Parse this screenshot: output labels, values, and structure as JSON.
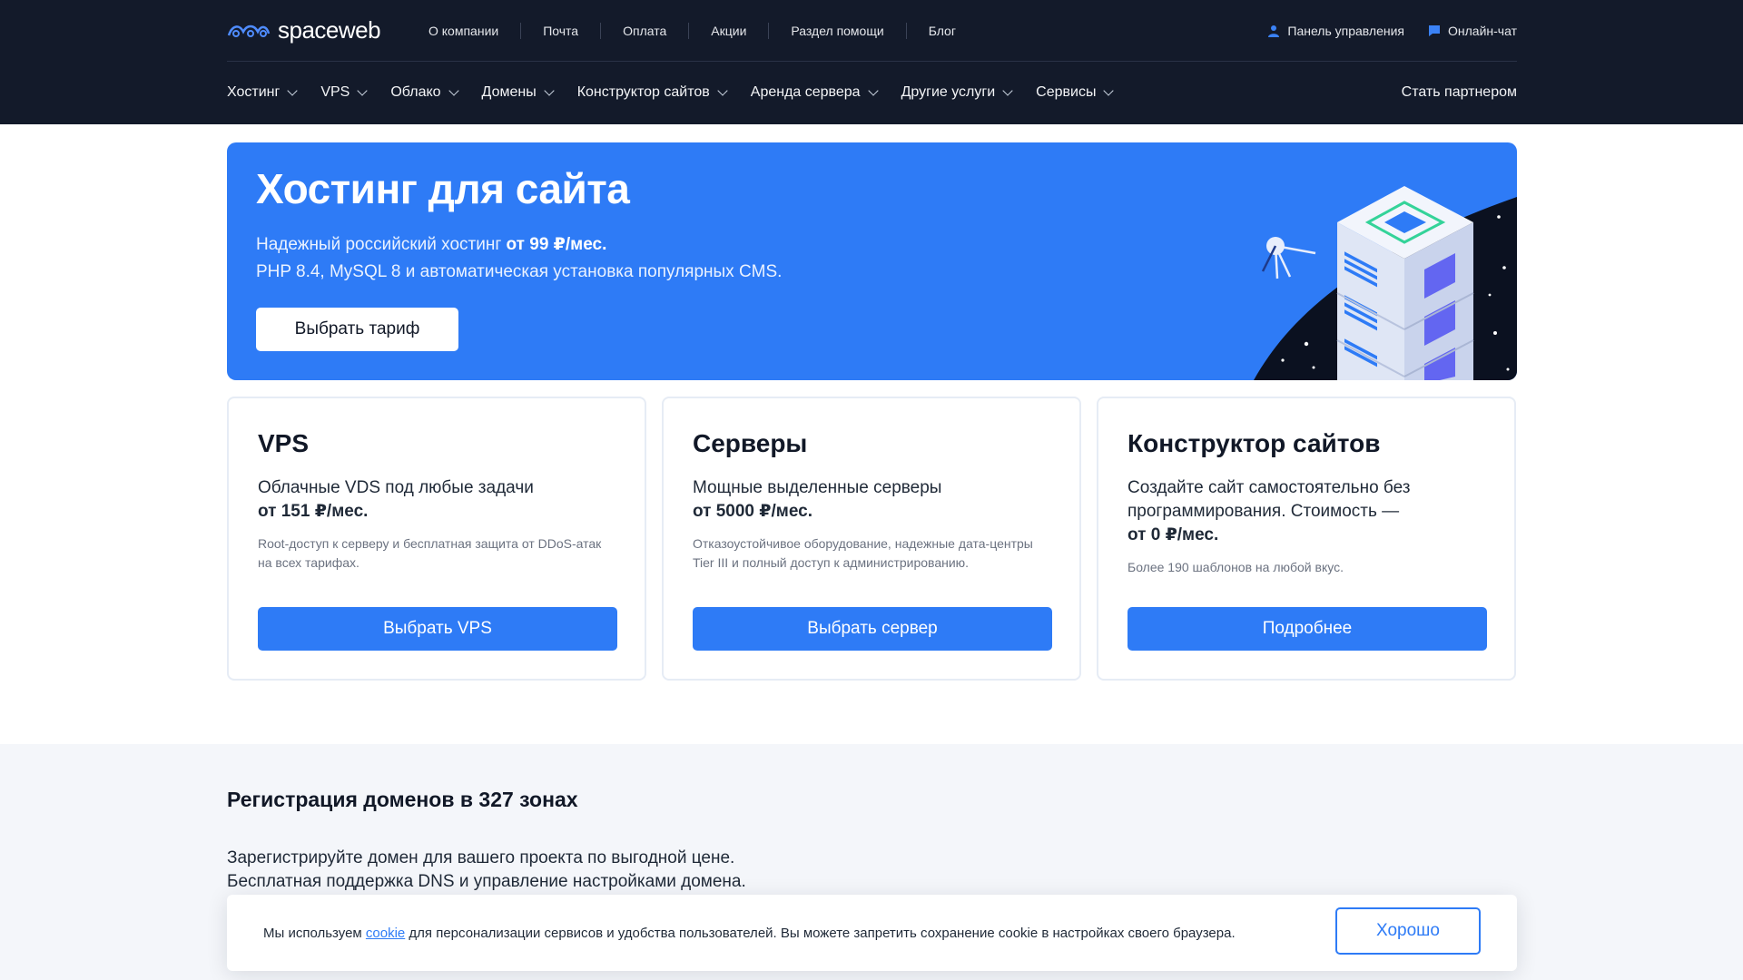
{
  "brand": {
    "name": "spaceweb",
    "accent": "#2e7bf6",
    "header_bg": "#131a2a"
  },
  "topnav": {
    "links": [
      "О компании",
      "Почта",
      "Оплата",
      "Акции",
      "Раздел помощи",
      "Блог"
    ],
    "control_panel": "Панель управления",
    "chat": "Онлайн-чат"
  },
  "mainnav": {
    "items": [
      "Хостинг",
      "VPS",
      "Облако",
      "Домены",
      "Конструктор сайтов",
      "Аренда сервера",
      "Другие услуги",
      "Сервисы"
    ],
    "partner": "Стать партнером"
  },
  "hero": {
    "title": "Хостинг для сайта",
    "line1_prefix": "Надежный российский хостинг ",
    "line1_price": "от 99 ₽/мес.",
    "line2": "PHP 8.4, MySQL 8 и автоматическая установка популярных CMS.",
    "button": "Выбрать тариф"
  },
  "cards": [
    {
      "title": "VPS",
      "desc": "Облачные VDS под любые задачи",
      "price": "от 151 ₽/мес.",
      "note": "Root-доступ к серверу и бесплатная защита от DDoS-атак на всех тарифах.",
      "button": "Выбрать VPS"
    },
    {
      "title": "Серверы",
      "desc": "Мощные выделенные серверы",
      "price": "от 5000 ₽/мес.",
      "note": "Отказоустойчивое оборудование, надежные дата-центры Tier III и полный доступ к администрированию.",
      "button": "Выбрать сервер"
    },
    {
      "title": "Конструктор сайтов",
      "desc": "Создайте сайт самостоятельно без программирования. Стоимость —",
      "price": "от 0 ₽/мес.",
      "note": "Более 190 шаблонов на любой вкус.",
      "button": "Подробнее"
    }
  ],
  "domains": {
    "title": "Регистрация доменов в 327 зонах",
    "line1": "Зарегистрируйте домен для вашего проекта по выгодной цене.",
    "line2": "Бесплатная поддержка DNS и управление настройками домена."
  },
  "cookie": {
    "prefix": "Мы используем ",
    "link": "cookie",
    "suffix": " для персонализации сервисов и удобства пользователей. Вы можете запретить сохранение cookie в настройках своего браузера.",
    "button": "Хорошо"
  }
}
